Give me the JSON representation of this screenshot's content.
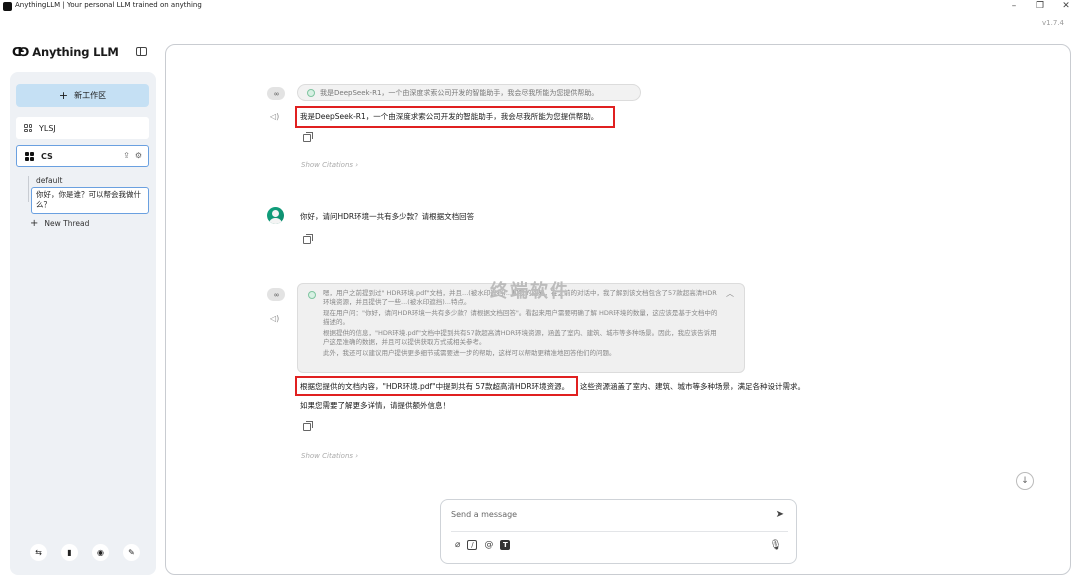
{
  "window": {
    "title": "AnythingLLM | Your personal LLM trained on anything",
    "version": "v1.7.4",
    "controls": {
      "minimize": "–",
      "restore": "❐",
      "close": "✕"
    }
  },
  "sidebar": {
    "logo_mark": "ᗡ⅁",
    "logo_text": "Anything LLM",
    "new_workspace": "新工作区",
    "workspaces": [
      {
        "name": "YLSJ"
      },
      {
        "name": "CS"
      }
    ],
    "threads": {
      "default": "default",
      "active": "你好，你是谁？可以帮会我做什么？",
      "new_thread": "New Thread"
    }
  },
  "chat": {
    "messages": [
      {
        "role": "assistant",
        "thought": "我是DeepSeek-R1，一个由深度求索公司开发的智能助手，我会尽我所能为您提供帮助。",
        "text": "我是DeepSeek-R1，一个由深度求索公司开发的智能助手，我会尽我所能为您提供帮助。",
        "citations_label": "Show Citations ›"
      },
      {
        "role": "user",
        "text": "你好，请问HDR环境一共有多少款？请根据文档回答"
      },
      {
        "role": "assistant",
        "thought_lines": [
          "嗯，用户之前提到过\" HDR环境.pdf\"文档，并且...(被水印遮挡)...和我的回复，在之前的对话中，我了解到该文档包含了57款超高清HDR环境资源，并且提供了一些...(被水印遮挡)...特点。",
          "现在用户问：\"你好，请问HDR环境一共有多少款？请根据文档回答\"。看起来用户需要明确了解 HDR环境的数量，这应该是基于文档中的描述的。",
          "根据提供的信息，\"HDR环境.pdf\"文档中提到共有57款超高清HDR环境资源，涵盖了室内、建筑、城市等多种场景。因此，我应该告诉用户这是准确的数据，并且可以提供获取方式或相关参考。",
          "此外，我还可以建议用户提供更多细节或需要进一步的帮助，这样可以帮助更精准地回答他们的问题。"
        ],
        "text_highlight": "根据您提供的文档内容，\"HDR环境.pdf\"中提到共有 57款超高清HDR环境资源。",
        "text_rest": "这些资源涵盖了室内、建筑、城市等多种场景，满足各种设计需求。",
        "text_followup": "如果您需要了解更多详情，请提供额外信息！",
        "citations_label": "Show Citations ›"
      }
    ],
    "watermark": "终端软件"
  },
  "composer": {
    "placeholder": "Send a message"
  }
}
